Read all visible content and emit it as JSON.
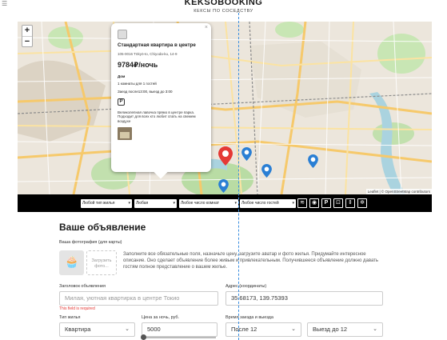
{
  "header": {
    "logo_title": "KEKSOBOOKING",
    "logo_subtitle": "КЕКСЫ ПО СОСЕДСТВУ"
  },
  "map": {
    "zoom_in": "+",
    "zoom_out": "−",
    "attribution": "Leaflet | © OpenStreetMap contributors"
  },
  "popup": {
    "title": "Стандартная квартира в центре",
    "address": "105-0016 Tōkyō-to, Chiyoda-ku, 14-9",
    "price": "9784₽/ночь",
    "type": "Дом",
    "capacity": "1 комнаты для 1 гостей",
    "time": "Заезд после13:00, выезд до 3:00",
    "feature": "P",
    "description": "Великолепная лавочка прямо в центре парка. Подходит для всех кто любит спать на свежем воздухе",
    "close": "×"
  },
  "filters": {
    "housing_type": "Любой тип жилья",
    "price": "Любая",
    "rooms": "Любое число комнат",
    "guests": "Любое число гостей",
    "features": [
      "wifi-icon",
      "dishwasher-icon",
      "parking-icon",
      "washer-icon",
      "elevator-icon",
      "conditioner-icon"
    ]
  },
  "form": {
    "title": "Ваше объявление",
    "photo_label": "Ваша фотография (для карты)",
    "upload_label": "Загрузить фото...",
    "note": "Заполните все обязательные поля, назначьте цену, загрузите аватар и фото жилья. Придумайте интересное описание. Оно сделает объявление более живым и привлекательным. Получившееся объявление должно давать гостям полное представление о вашем жилье.",
    "title_label": "Заголовок объявления",
    "title_placeholder": "Милая, уютная квартирка в центре Токио",
    "title_error": "This field is required",
    "address_label": "Адрес (координаты)",
    "address_value": "35.68173, 139.75393",
    "type_label": "Тип жилья",
    "type_value": "Квартира",
    "price_label": "Цена за ночь, руб.",
    "price_value": "5000",
    "time_label": "Время заезда и выезда",
    "checkin_value": "После 12",
    "checkout_value": "Выезд до 12"
  },
  "colors": {
    "main_pin": "#e53935",
    "pin": "#2a7fd4",
    "filters_bg": "#000000",
    "error": "#e53935"
  }
}
